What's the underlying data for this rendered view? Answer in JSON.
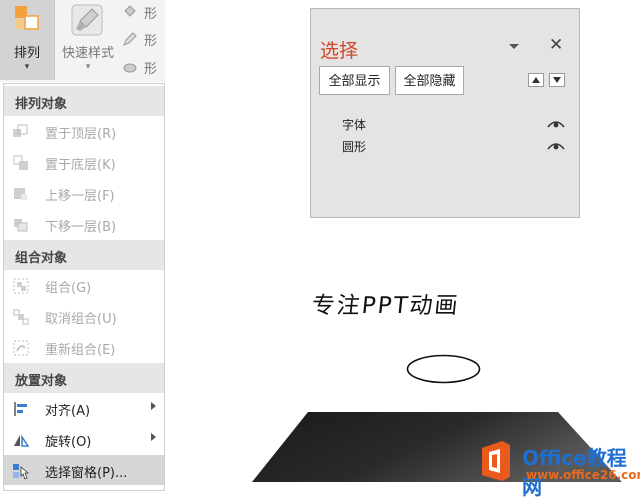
{
  "ribbon": {
    "arrange_label": "排列",
    "quick_styles_label": "快速样式",
    "shape_buttons": [
      "形",
      "形",
      "形"
    ],
    "dropdown_glyph": "▾"
  },
  "menu": {
    "sections": [
      {
        "header": "排列对象",
        "items": [
          {
            "label": "置于顶层(R)",
            "icon": "bring-to-front-icon",
            "enabled": false
          },
          {
            "label": "置于底层(K)",
            "icon": "send-to-back-icon",
            "enabled": false
          },
          {
            "label": "上移一层(F)",
            "icon": "bring-forward-icon",
            "enabled": false
          },
          {
            "label": "下移一层(B)",
            "icon": "send-backward-icon",
            "enabled": false
          }
        ]
      },
      {
        "header": "组合对象",
        "items": [
          {
            "label": "组合(G)",
            "icon": "group-icon",
            "enabled": false
          },
          {
            "label": "取消组合(U)",
            "icon": "ungroup-icon",
            "enabled": false
          },
          {
            "label": "重新组合(E)",
            "icon": "regroup-icon",
            "enabled": false
          }
        ]
      },
      {
        "header": "放置对象",
        "items": [
          {
            "label": "对齐(A)",
            "icon": "align-icon",
            "enabled": true,
            "submenu": true
          },
          {
            "label": "旋转(O)",
            "icon": "rotate-icon",
            "enabled": true,
            "submenu": true
          },
          {
            "label": "选择窗格(P)...",
            "icon": "selection-pane-icon",
            "enabled": true,
            "highlighted": true
          }
        ]
      }
    ]
  },
  "selection_pane": {
    "title": "选择",
    "close_glyph": "✕",
    "show_all": "全部显示",
    "hide_all": "全部隐藏",
    "objects": [
      "字体",
      "圆形"
    ]
  },
  "slide": {
    "text": "专注PPT动画"
  },
  "watermark": {
    "brand": "Office教程网",
    "url": "www.office26.com"
  },
  "colors": {
    "accent": "#d24726",
    "brand_blue": "#1f6fd1",
    "brand_orange": "#e86a1f"
  }
}
